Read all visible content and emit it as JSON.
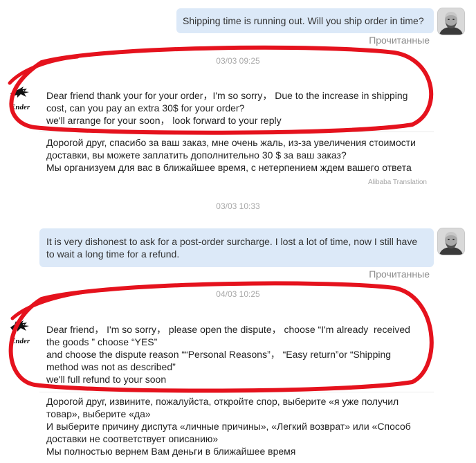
{
  "conversation": {
    "user_messages": [
      {
        "lines": [
          "Shipping time is running out. Will you ship order in time?"
        ],
        "status": "Прочитанные",
        "avatar_icon": "user-avatar-photo"
      },
      {
        "lines": [
          "It is very dishonest to ask for a post-order surcharge. I lost a lot of time, now I still have",
          "to wait a long time for a refund."
        ],
        "status": "Прочитанные",
        "avatar_icon": "user-avatar-photo"
      }
    ],
    "timestamps": [
      "03/03 09:25",
      "03/03 10:33",
      "04/03 10:25"
    ],
    "seller": {
      "logo_text": "Ender",
      "logo_icon": "ender-dragon-logo"
    },
    "seller_messages": [
      {
        "lines": [
          "Dear friend thank your for your order，I'm so sorry， Due to the increase in shipping",
          "cost, can you pay an extra 30$ for your order?",
          "we'll arrange for your soon， look forward to your reply"
        ],
        "translation": [
          "Дорогой друг, спасибо за ваш заказ, мне очень жаль, из-за увеличения стоимости",
          "доставки, вы можете заплатить дополнительно 30 $ за ваш заказ?",
          "Мы организуем для вас в ближайшее время, с нетерпением ждем вашего ответа"
        ],
        "translation_label": "Alibaba Translation"
      },
      {
        "lines": [
          "Dear friend， I'm so sorry， please open the dispute， choose “I'm already  received",
          "the goods ” choose “YES”",
          "and choose the dispute reason ““Personal Reasons”， “Easy return”or “Shipping",
          "method was not as described”",
          "we'll full refund to your soon"
        ],
        "translation": [
          "Дорогой друг, извините, пожалуйста, откройте спор, выберите «я уже получил",
          "товар», выберите «да»",
          "И выберите причину диспута «личные причины», «Легкий возврат» или «Способ",
          "доставки не соответствует описанию»",
          "Мы полностью вернем Вам деньги в ближайшее время"
        ]
      }
    ]
  },
  "colors": {
    "user_bubble": "#dce9f8",
    "annotation_stroke": "#e5121d",
    "text": "#222222",
    "muted": "#999999"
  }
}
